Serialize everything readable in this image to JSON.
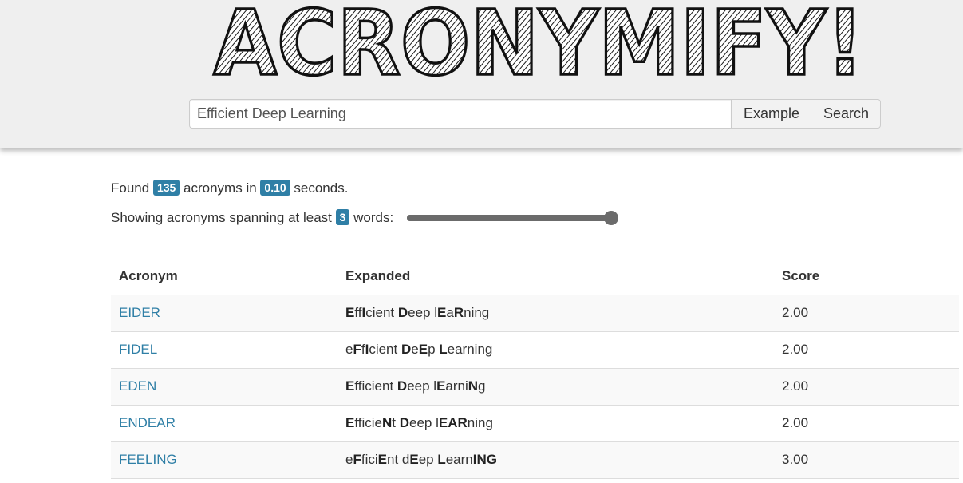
{
  "app": {
    "logo_text": "ACRONYMIFY!"
  },
  "search": {
    "value": "Efficient Deep Learning",
    "example_label": "Example",
    "search_label": "Search"
  },
  "stats": {
    "found_prefix": "Found",
    "count": "135",
    "middle": "acronyms in",
    "seconds": "0.10",
    "suffix": "seconds.",
    "span_prefix": "Showing acronyms spanning at least",
    "min_words": "3",
    "span_suffix": "words:",
    "slider_fraction": 1.0
  },
  "table": {
    "headers": {
      "acronym": "Acronym",
      "expanded": "Expanded",
      "score": "Score"
    },
    "rows": [
      {
        "acronym": "EIDER",
        "expanded": [
          [
            "E",
            1
          ],
          [
            "ff",
            0
          ],
          [
            "I",
            1
          ],
          [
            "cient ",
            0
          ],
          [
            "D",
            1
          ],
          [
            "eep l",
            0
          ],
          [
            "E",
            1
          ],
          [
            "a",
            0
          ],
          [
            "R",
            1
          ],
          [
            "ning",
            0
          ]
        ],
        "score": "2.00"
      },
      {
        "acronym": "FIDEL",
        "expanded": [
          [
            "e",
            0
          ],
          [
            "F",
            1
          ],
          [
            "f",
            0
          ],
          [
            "I",
            1
          ],
          [
            "cient ",
            0
          ],
          [
            "D",
            1
          ],
          [
            "e",
            0
          ],
          [
            "E",
            1
          ],
          [
            "p ",
            0
          ],
          [
            "L",
            1
          ],
          [
            "earning",
            0
          ]
        ],
        "score": "2.00"
      },
      {
        "acronym": "EDEN",
        "expanded": [
          [
            "E",
            1
          ],
          [
            "fficient ",
            0
          ],
          [
            "D",
            1
          ],
          [
            "eep l",
            0
          ],
          [
            "E",
            1
          ],
          [
            "arni",
            0
          ],
          [
            "N",
            1
          ],
          [
            "g",
            0
          ]
        ],
        "score": "2.00"
      },
      {
        "acronym": "ENDEAR",
        "expanded": [
          [
            "E",
            1
          ],
          [
            "fficie",
            0
          ],
          [
            "N",
            1
          ],
          [
            "t ",
            0
          ],
          [
            "D",
            1
          ],
          [
            "eep l",
            0
          ],
          [
            "EAR",
            1
          ],
          [
            "ning",
            0
          ]
        ],
        "score": "2.00"
      },
      {
        "acronym": "FEELING",
        "expanded": [
          [
            "e",
            0
          ],
          [
            "F",
            1
          ],
          [
            "fici",
            0
          ],
          [
            "E",
            1
          ],
          [
            "nt d",
            0
          ],
          [
            "E",
            1
          ],
          [
            "ep ",
            0
          ],
          [
            "L",
            1
          ],
          [
            "earn",
            0
          ],
          [
            "ING",
            1
          ]
        ],
        "score": "3.00"
      }
    ]
  },
  "colors": {
    "accent": "#2f7fa6",
    "header_bg": "#efefef",
    "slider": "#6b6b6b"
  }
}
